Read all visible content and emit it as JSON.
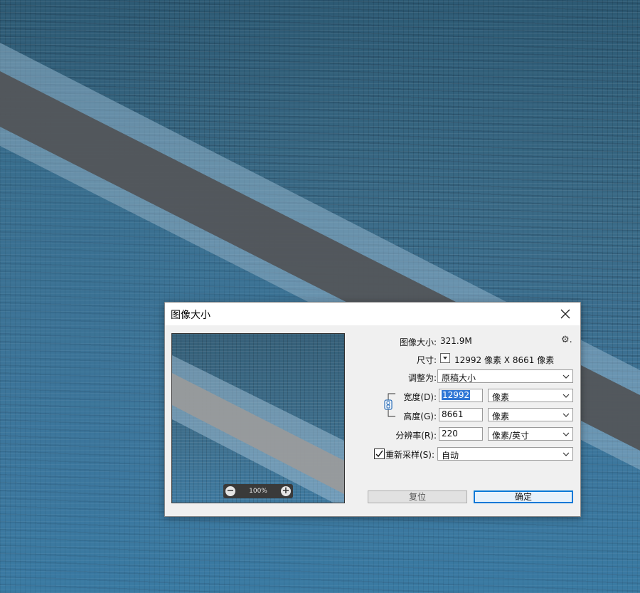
{
  "dialog": {
    "title": "图像大小",
    "image_size_label": "图像大小:",
    "image_size_value": "321.9M",
    "dimensions_label": "尺寸:",
    "dimensions_value": "12992 像素  X  8661 像素",
    "fit_to": {
      "label": "调整为:",
      "value": "原稿大小"
    },
    "width": {
      "label": "宽度(D):",
      "value": "12992",
      "unit": "像素"
    },
    "height": {
      "label": "高度(G):",
      "value": "8661",
      "unit": "像素"
    },
    "resolution": {
      "label": "分辨率(R):",
      "value": "220",
      "unit": "像素/英寸"
    },
    "resample": {
      "label": "重新采样(S):",
      "checked": true,
      "value": "自动"
    },
    "buttons": {
      "reset": "复位",
      "ok": "确定"
    },
    "preview": {
      "zoom": "100%"
    }
  },
  "icons": [
    "close-icon",
    "gear-icon",
    "dropdown-icon",
    "chain-link-icon",
    "zoom-out-icon",
    "zoom-in-icon",
    "checkmark-icon"
  ],
  "colors": {
    "accent": "#0078d7",
    "selection": "#3178d6"
  }
}
